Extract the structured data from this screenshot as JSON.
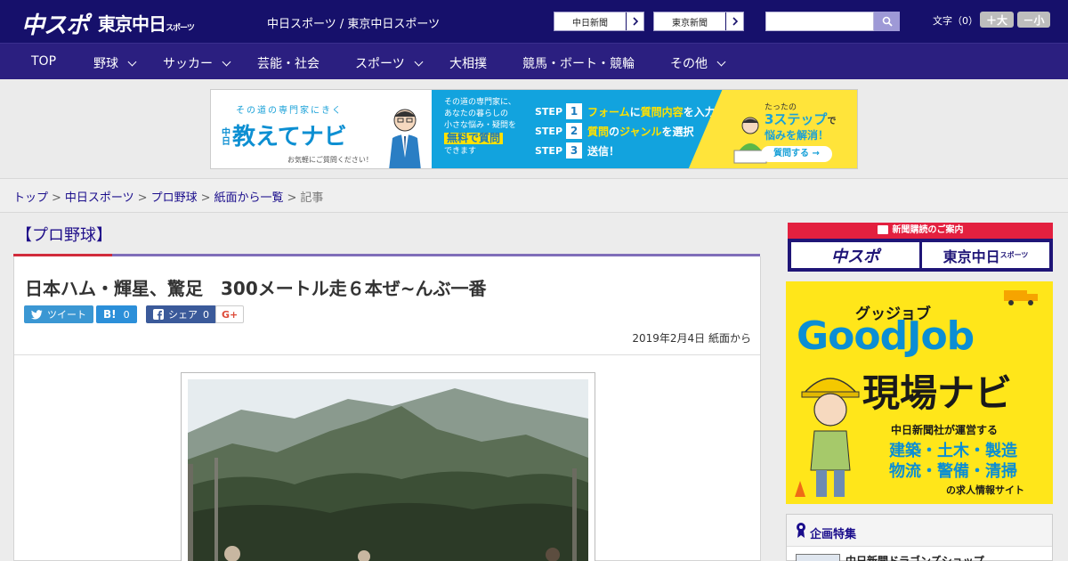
{
  "header": {
    "logo_chuspo": "中スポ",
    "logo_tokyo": "東京中日",
    "logo_tokyo_suffix": "スポーツ",
    "site_title": "中日スポーツ / 東京中日スポーツ",
    "paper_links": [
      {
        "label": "中日新聞"
      },
      {
        "label": "東京新聞"
      }
    ],
    "search": {
      "placeholder": ""
    },
    "font_size_label": "文字（0）",
    "font_larger": "＋大",
    "font_smaller": "－小"
  },
  "nav": {
    "items": [
      {
        "label": "TOP",
        "has_menu": false
      },
      {
        "label": "野球",
        "has_menu": true
      },
      {
        "label": "サッカー",
        "has_menu": true
      },
      {
        "label": "芸能・社会",
        "has_menu": false
      },
      {
        "label": "スポーツ",
        "has_menu": true
      },
      {
        "label": "大相撲",
        "has_menu": false
      },
      {
        "label": "競馬・ボート・競輪",
        "has_menu": false
      },
      {
        "label": "その他",
        "has_menu": true
      }
    ]
  },
  "ad_banner": {
    "tagline": "その道の専門家にきく",
    "brand_prefix": "中日",
    "brand": "教えてナビ",
    "sub": "お気軽にご質問ください！",
    "mid_line1": "その道の専門家に、",
    "mid_line2": "あなたの暮らしの",
    "mid_line3": "小さな悩み・疑問を",
    "mid_free": "無料で質問",
    "mid_line4": "できます",
    "step_label": "STEP",
    "steps": [
      {
        "num": "1",
        "text_a": "フォーム",
        "text_b": "に",
        "text_c": "質問内容",
        "text_d": "を入力"
      },
      {
        "num": "2",
        "text_a": "質問",
        "text_b": "の",
        "text_c": "ジャンル",
        "text_d": "を選択"
      },
      {
        "num": "3",
        "text_a": "送信！",
        "text_b": "",
        "text_c": "",
        "text_d": ""
      }
    ],
    "right_t1": "たったの",
    "right_t2": "3ステップ",
    "right_t2b": "で",
    "right_t3": "悩みを解消！",
    "right_btn": "質問する →"
  },
  "breadcrumb": {
    "items": [
      "トップ",
      "中日スポーツ",
      "プロ野球",
      "紙面から一覧"
    ],
    "current": "記事",
    "separator": ">"
  },
  "article": {
    "section": "【プロ野球】",
    "headline": "日本ハム・輝星、驚足　300メートル走６本ぜ~んぶ一番",
    "share": {
      "tweet": "ツイート",
      "hatena_label": "B!",
      "hatena_count": "0",
      "facebook_label": "シェア",
      "facebook_count": "0",
      "gplus": "G+"
    },
    "date": "2019年2月4日 紙面から"
  },
  "sidebar": {
    "subscribe_head": "新聞購読のご案内",
    "subscribe_logos": [
      "中スポ",
      "東京中日"
    ],
    "subscribe_logo_suffix": "スポーツ",
    "job_ad": {
      "kana": "グッジョブ",
      "title": "GoodJob",
      "title2": "現場ナビ",
      "run": "中日新聞社が運営する",
      "line1": "建築・土木・製造",
      "line2": "物流・警備・清掃",
      "bottom": "の求人情報サイト"
    },
    "special_title": "企画特集",
    "special_item": "中日新聞ドラゴンズショップ"
  }
}
